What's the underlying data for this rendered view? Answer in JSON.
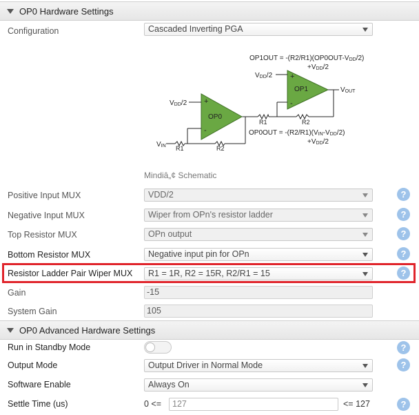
{
  "header1": {
    "title": "OP0 Hardware Settings"
  },
  "configuration": {
    "label": "Configuration",
    "value": "Cascaded Inverting PGA"
  },
  "schematic": {
    "op1out_eq": "OP1OUT = -(R2/R1)(OP0OUT-V",
    "op1out_eq_sub": "DD",
    "op1out_eq_end": "/2)",
    "op1out_eq2": "+V",
    "op1out_eq2_sub": "DD",
    "op1out_eq2_end": "/2",
    "op0out_eq": "OP0OUT = -(R2/R1)(V",
    "op0out_eq_sub": "IN",
    "op0out_eq_mid": "-V",
    "op0out_eq_sub2": "DD",
    "op0out_eq_end": "/2)",
    "op0out_eq2": "+V",
    "op0out_eq2_sub": "DD",
    "op0out_eq2_end": "/2",
    "op0_label": "OP0",
    "op1_label": "OP1",
    "vdd2_a": "V",
    "vdd2_a_sub": "DD",
    "vdd2_a_end": "/2",
    "vdd2_b": "V",
    "vdd2_b_sub": "DD",
    "vdd2_b_end": "/2",
    "vout": "V",
    "vout_sub": "OUT",
    "vin": "V",
    "vin_sub": "IN",
    "r1_a": "R1",
    "r2_a": "R2",
    "r1_b": "R1",
    "r2_b": "R2",
    "plus": "+",
    "minus": "-",
    "caption": "Mindiâ„¢ Schematic",
    "opamp_color": "#6aa843"
  },
  "fields": {
    "positive_input_mux": {
      "label": "Positive Input MUX",
      "value": "VDD/2"
    },
    "negative_input_mux": {
      "label": "Negative Input MUX",
      "value": "Wiper from OPn's resistor ladder"
    },
    "top_resistor_mux": {
      "label": "Top Resistor MUX",
      "value": "OPn output"
    },
    "bottom_resistor_mux": {
      "label": "Bottom Resistor MUX",
      "value": "Negative input pin for OPn"
    },
    "wiper_mux": {
      "label": "Resistor Ladder Pair Wiper MUX",
      "value": "R1 = 1R, R2 = 15R, R2/R1 = 15"
    },
    "gain": {
      "label": "Gain",
      "value": "-15"
    },
    "system_gain": {
      "label": "System Gain",
      "value": "105"
    }
  },
  "header2": {
    "title": "OP0 Advanced Hardware Settings"
  },
  "advanced": {
    "standby": {
      "label": "Run in Standby Mode",
      "state": "off"
    },
    "output_mode": {
      "label": "Output Mode",
      "value": "Output Driver in Normal Mode"
    },
    "software_enable": {
      "label": "Software Enable",
      "value": "Always On"
    },
    "settle_time": {
      "label": "Settle Time (us)",
      "min_label": "0 <=",
      "value": "127",
      "max_label": "<= 127"
    }
  },
  "help_glyph": "?",
  "colors": {
    "highlight": "#e0242b",
    "help_icon": "#9ec3ea"
  }
}
